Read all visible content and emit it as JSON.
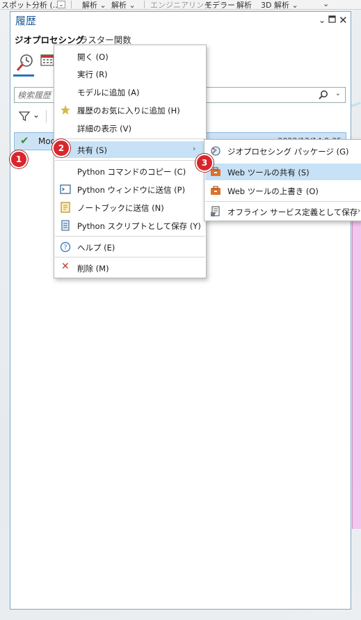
{
  "ribbon": {
    "spot_analysis": "スポット分析 (...",
    "analysis1": "解析",
    "analysis2": "解析",
    "engineering": "エンジニアリング",
    "modeler": "モデラー",
    "analysis3": "解析",
    "analysis3d": "3D 解析"
  },
  "pane": {
    "title": "履歴",
    "tabs": [
      "ジオプロセシング",
      "ラスター関数"
    ],
    "search_placeholder": "検索履歴",
    "history_row": {
      "label": "Mod",
      "date": "2022/12/14 9:35"
    }
  },
  "context_menu": {
    "items": [
      {
        "label": "開く (O)",
        "icon": ""
      },
      {
        "label": "実行 (R)",
        "icon": ""
      },
      {
        "label": "モデルに追加 (A)",
        "icon": ""
      },
      {
        "label": "履歴のお気に入りに追加 (H)",
        "icon": "star-icon"
      },
      {
        "label": "詳細の表示 (V)",
        "icon": ""
      },
      {
        "label": "共有 (S)",
        "icon": ""
      },
      {
        "label": "Python コマンドのコピー (C)",
        "icon": ""
      },
      {
        "label": "Python ウィンドウに送信 (P)",
        "icon": "python-window-icon"
      },
      {
        "label": "ノートブックに送信 (N)",
        "icon": "notebook-icon"
      },
      {
        "label": "Python スクリプトとして保存 (Y)",
        "icon": "python-script-icon"
      },
      {
        "label": "ヘルプ (E)",
        "icon": "help-icon"
      },
      {
        "label": "削除 (M)",
        "icon": "delete-icon"
      }
    ]
  },
  "submenu": {
    "items": [
      {
        "label": "ジオプロセシング パッケージ (G)",
        "icon": "gp-package-icon"
      },
      {
        "label": "Web ツールの共有 (S)",
        "icon": "web-tool-share-icon"
      },
      {
        "label": "Web ツールの上書き (O)",
        "icon": "web-tool-overwrite-icon"
      },
      {
        "label": "オフライン サービス定義として保存 (D)",
        "icon": "service-definition-icon"
      }
    ]
  },
  "badges": [
    "1",
    "2",
    "3"
  ],
  "colors": {
    "accent": "#1b5a94",
    "highlight": "#c7e1f6",
    "badge": "#d9262c"
  }
}
